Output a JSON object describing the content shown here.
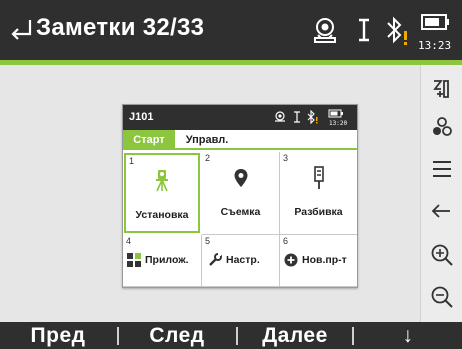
{
  "titlebar": {
    "title": "Заметки 32/33",
    "time": "13:23"
  },
  "screen_thumbnail": {
    "title": "J101",
    "time": "13:20",
    "tabs": [
      {
        "label": "Старт",
        "active": true
      },
      {
        "label": "Управл.",
        "active": false
      }
    ],
    "tiles": [
      {
        "number": "1",
        "label": "Установка",
        "icon": "tripod-icon",
        "selected": true
      },
      {
        "number": "2",
        "label": "Съемка",
        "icon": "location-pin-icon",
        "selected": false
      },
      {
        "number": "3",
        "label": "Разбивка",
        "icon": "pole-icon",
        "selected": false
      },
      {
        "number": "4",
        "label": "Прилож.",
        "icon": "apps-icon",
        "selected": false
      },
      {
        "number": "5",
        "label": "Настр.",
        "icon": "wrench-icon",
        "selected": false
      },
      {
        "number": "6",
        "label": "Нов.пр-т",
        "icon": "add-project-icon",
        "selected": false
      }
    ]
  },
  "toolbar_right": [
    "measure-config-icon",
    "stakeout-icon",
    "menu-icon",
    "back-icon",
    "zoom-in-icon",
    "zoom-out-icon"
  ],
  "bottombar": {
    "f1": "Пред",
    "f2": "След",
    "f3": "Далее",
    "f4": "↓"
  },
  "colors": {
    "accent": "#8cc63f",
    "warning": "#f2a900",
    "bar": "#2f2f2f",
    "background": "#e6e6e6"
  }
}
